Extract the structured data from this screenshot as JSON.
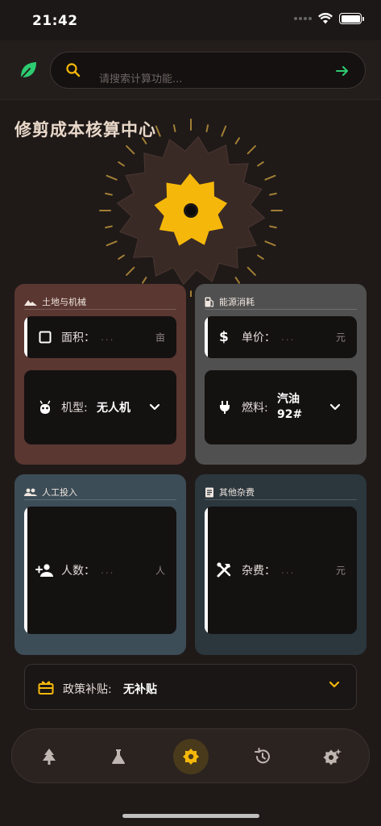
{
  "status_bar": {
    "time": "21:42"
  },
  "search": {
    "placeholder": "请搜索计算功能..."
  },
  "page_title": "修剪成本核算中心",
  "cards": {
    "land": {
      "title": "土地与机械",
      "area_label": "面积：",
      "area_placeholder": "...",
      "area_unit": "亩",
      "model_label": "机型:",
      "model_value": "无人机"
    },
    "energy": {
      "title": "能源消耗",
      "price_label": "单价：",
      "price_placeholder": "...",
      "price_unit": "元",
      "fuel_label": "燃料:",
      "fuel_value_line1": "汽油",
      "fuel_value_line2": "92#"
    },
    "labor": {
      "title": "人工投入",
      "count_label": "人数：",
      "count_placeholder": "...",
      "count_unit": "人"
    },
    "misc": {
      "title": "其他杂费",
      "fee_label": "杂费：",
      "fee_placeholder": "...",
      "fee_unit": "元"
    }
  },
  "policy": {
    "label": "政策补贴:",
    "value": "无补贴"
  },
  "tabbar": {
    "items": [
      "tree-icon",
      "flask-icon",
      "gear-icon",
      "history-icon",
      "settings-sparkle-icon"
    ],
    "active_index": 2
  },
  "colors": {
    "accent": "#f5b80a",
    "green": "#2ecc71",
    "land_card": "#5a3731",
    "energy_card": "#505050",
    "labor_card": "#3d4d57",
    "misc_card": "#2b363d"
  }
}
